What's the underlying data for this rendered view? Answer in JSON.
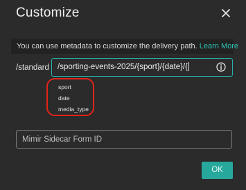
{
  "dialog": {
    "title": "Customize",
    "close_icon": "close-icon"
  },
  "info": {
    "text": "You can use metadata to customize the delivery path. ",
    "link": "Learn More"
  },
  "path": {
    "prefix": "/standard",
    "value": "/sporting-events-2025/{sport}/{date}/{",
    "info_icon": "info-circle-icon"
  },
  "suggestions": {
    "items": [
      "sport",
      "date",
      "media_type"
    ]
  },
  "sidecar": {
    "placeholder": "Mimir Sidecar Form ID",
    "value": ""
  },
  "footer": {
    "ok_label": "OK"
  },
  "colors": {
    "accent": "#27b3a8",
    "highlight_ring": "#e2231a",
    "background": "#2b2b2b"
  }
}
